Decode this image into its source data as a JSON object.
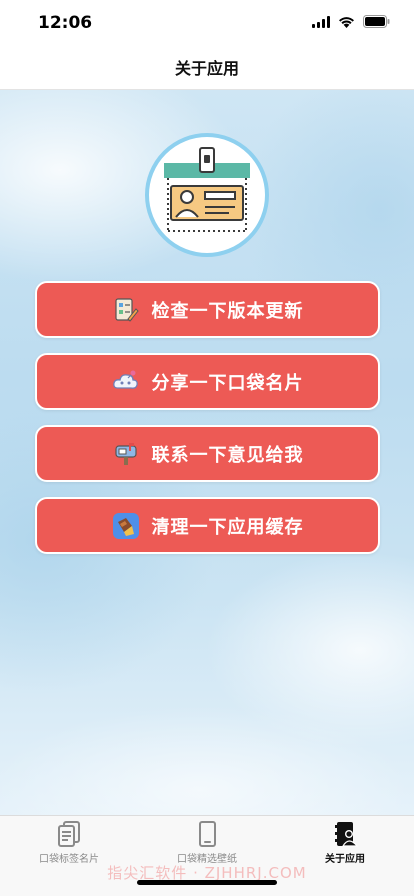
{
  "status_bar": {
    "time": "12:06"
  },
  "nav": {
    "title": "关于应用"
  },
  "actions": [
    {
      "label": "检查一下版本更新",
      "icon": "checklist-icon"
    },
    {
      "label": "分享一下口袋名片",
      "icon": "share-cloud-icon"
    },
    {
      "label": "联系一下意见给我",
      "icon": "mailbox-icon"
    },
    {
      "label": "清理一下应用缓存",
      "icon": "broom-icon"
    }
  ],
  "tabs": [
    {
      "label": "口袋标签名片",
      "icon": "document-icon",
      "active": false
    },
    {
      "label": "口袋精选壁纸",
      "icon": "phone-icon",
      "active": false
    },
    {
      "label": "关于应用",
      "icon": "profile-card-icon",
      "active": true
    }
  ],
  "watermark": "指尖汇软件 · ZJHHRJ.COM",
  "colors": {
    "button": "#ed5a55",
    "ring": "#8ed0ef",
    "badge_top": "#5bb8a6",
    "badge_card": "#f6c982"
  }
}
